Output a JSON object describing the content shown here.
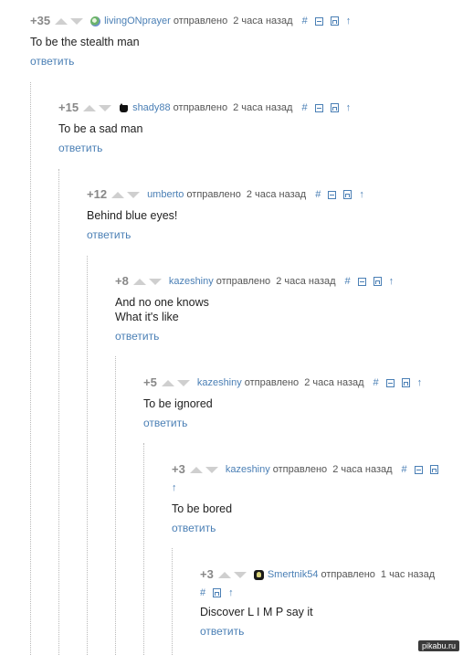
{
  "comments": [
    {
      "rating": "+35",
      "user": "livingONprayer",
      "avatar": "globe",
      "sent": "отправлено",
      "time": "2 часа назад",
      "text": "To be the stealth man",
      "reply": "ответить"
    },
    {
      "rating": "+15",
      "user": "shady88",
      "avatar": "mask",
      "sent": "отправлено",
      "time": "2 часа назад",
      "text": "To be a sad man",
      "reply": "ответить"
    },
    {
      "rating": "+12",
      "user": "umberto",
      "avatar": "none",
      "sent": "отправлено",
      "time": "2 часа назад",
      "text": "Behind blue eyes!",
      "reply": "ответить"
    },
    {
      "rating": "+8",
      "user": "kazeshiny",
      "avatar": "none",
      "sent": "отправлено",
      "time": "2 часа назад",
      "text": "And no one knows\nWhat it's like",
      "reply": "ответить"
    },
    {
      "rating": "+5",
      "user": "kazeshiny",
      "avatar": "none",
      "sent": "отправлено",
      "time": "2 часа назад",
      "text": "To be ignored",
      "reply": "ответить"
    },
    {
      "rating": "+3",
      "user": "kazeshiny",
      "avatar": "none",
      "sent": "отправлено",
      "time": "2 часа назад",
      "text": "To be bored",
      "reply": "ответить"
    },
    {
      "rating": "+3",
      "user": "Smertnik54",
      "avatar": "skull",
      "sent": "отправлено",
      "time": "1 час назад",
      "text": "Discover L I M P say it",
      "reply": "ответить"
    }
  ],
  "tools": {
    "hash": "#",
    "parent_arrow": "↑"
  },
  "watermark": "pikabu.ru",
  "colors": {
    "link": "#4a7fb5",
    "rating": "#888888",
    "vote_arrow": "#cfcfcf",
    "thread_line": "#b9b9b9"
  }
}
